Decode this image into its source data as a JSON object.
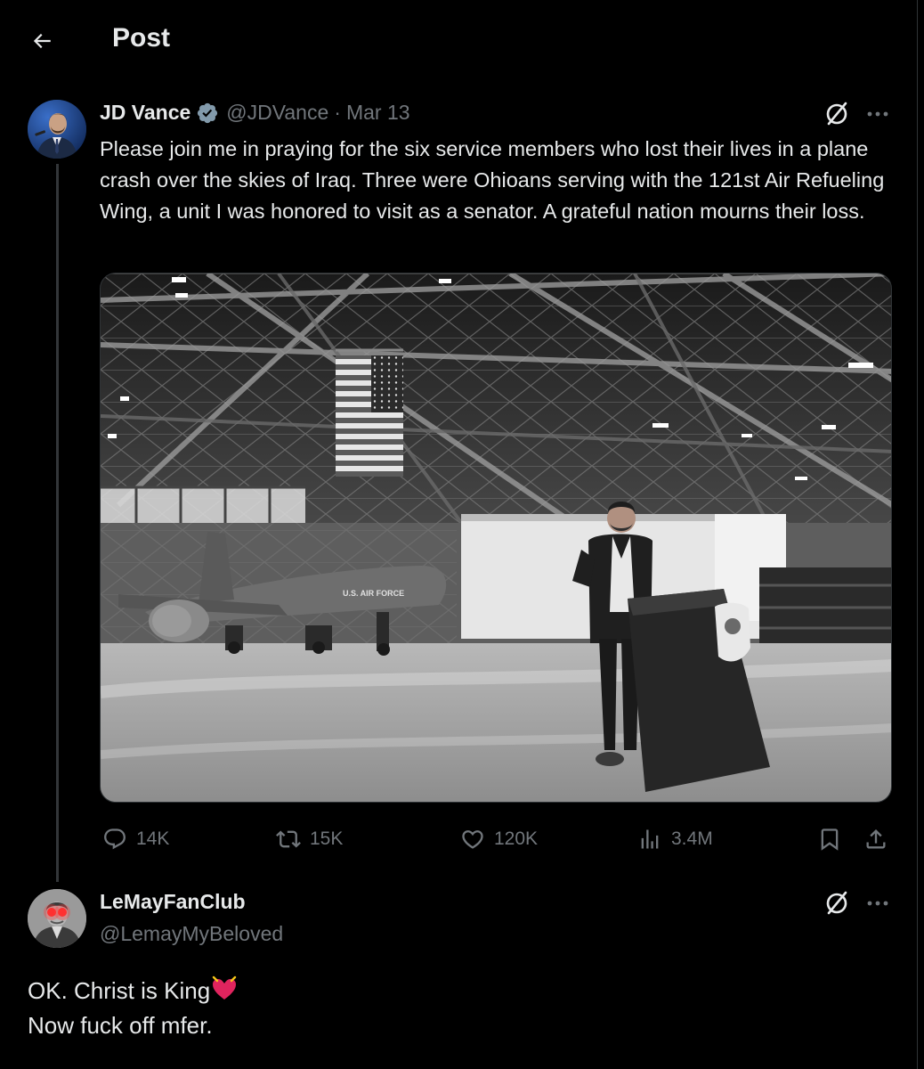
{
  "header": {
    "title": "Post",
    "back_icon": "arrow-left-icon"
  },
  "tweet": {
    "name": "JD Vance",
    "handle": "@JDVance",
    "separator": "·",
    "date": "Mar 13",
    "text": "Please join me in praying for the six service members who lost their lives in a plane crash over the skies of Iraq. Three were Ohioans serving with the 121st Air Refueling Wing, a unit I was honored to visit as a senator. A grateful nation mourns their loss.",
    "image_text": {
      "plane_marking": "U.S. AIR FORCE"
    },
    "stats": {
      "replies": "14K",
      "reposts": "15K",
      "likes": "120K",
      "views": "3.4M"
    }
  },
  "reply": {
    "name": "LeMayFanClub",
    "handle": "@LemayMyBeloved",
    "line1": "OK. Christ is King",
    "line2": "Now fuck off mfer."
  },
  "colors": {
    "background": "#000000",
    "text": "#e7e9ea",
    "secondary": "#71767b",
    "verified": "#829aab",
    "border": "#2f3336"
  }
}
